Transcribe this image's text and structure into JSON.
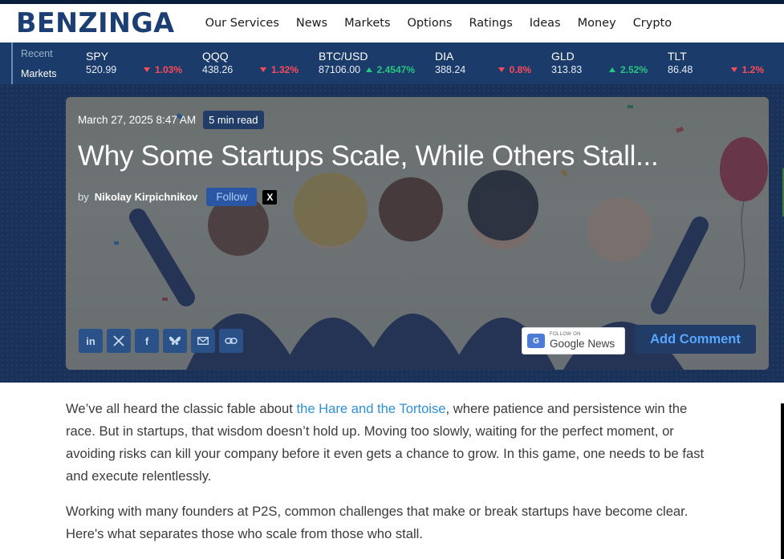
{
  "header": {
    "logo": "BENZINGA",
    "nav": [
      "Our Services",
      "News",
      "Markets",
      "Options",
      "Ratings",
      "Ideas",
      "Money",
      "Crypto"
    ]
  },
  "ticker": {
    "label_1": "Recent",
    "label_2": "Markets",
    "items": [
      {
        "symbol": "SPY",
        "price": "520.99",
        "change": "1.03%",
        "direction": "down"
      },
      {
        "symbol": "QQQ",
        "price": "438.26",
        "change": "1.32%",
        "direction": "down"
      },
      {
        "symbol": "BTC/USD",
        "price": "87106.00",
        "change": "2.4547%",
        "direction": "up"
      },
      {
        "symbol": "DIA",
        "price": "388.24",
        "change": "0.8%",
        "direction": "down"
      },
      {
        "symbol": "GLD",
        "price": "313.83",
        "change": "2.52%",
        "direction": "up"
      },
      {
        "symbol": "TLT",
        "price": "86.48",
        "change": "1.2%",
        "direction": "down"
      }
    ]
  },
  "hero": {
    "date": "March 27, 2025 8:47 AM",
    "read_time": "5 min read",
    "title": "Why Some Startups Scale, While Others Stall...",
    "by": "by",
    "author": "Nikolay Kirpichnikov",
    "follow_label": "Follow",
    "x_label": "X",
    "share_icons": [
      "linkedin-icon",
      "x-icon",
      "facebook-icon",
      "bluesky-icon",
      "email-icon",
      "link-icon"
    ],
    "gnews_small": "FOLLOW ON",
    "gnews_big_1": "Google",
    "gnews_big_2": "News",
    "add_comment": "Add Comment"
  },
  "article": {
    "p1_before": "We’ve all heard the classic fable about ",
    "p1_link": "the Hare and the Tortoise",
    "p1_after": ", where patience and persistence win the race. But in startups, that wisdom doesn’t hold up. Moving too slowly, waiting for the perfect moment, or avoiding risks can kill your company before it even gets a chance to grow. In this game, one needs to be fast and execute relentlessly.",
    "p2": "Working with many founders at P2S, common challenges that make or break startups have become clear. Here's what separates those who scale from those who stall."
  },
  "colors": {
    "brand": "#1c3f73",
    "ticker_bg": "#1b3b6a",
    "down": "#ff4a5a",
    "up": "#27c77e",
    "link": "#2e8fd6"
  }
}
